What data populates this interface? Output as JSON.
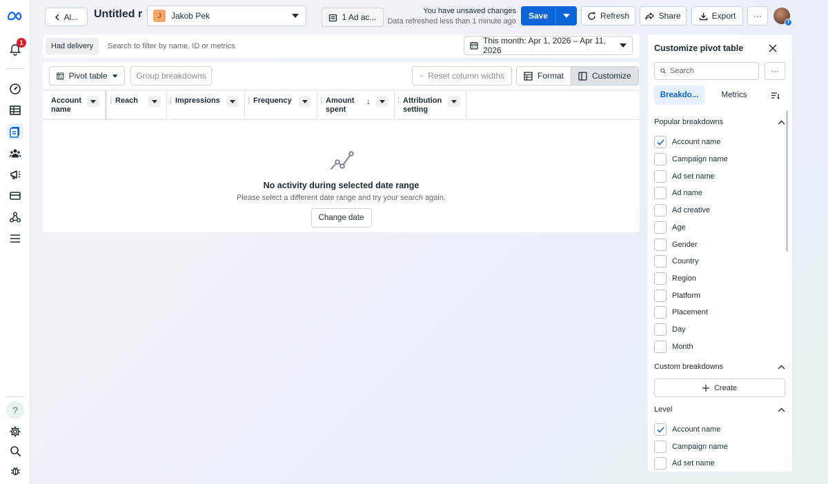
{
  "rail": {
    "notification_count": "1",
    "help_label": "?"
  },
  "header": {
    "back_label": "Al...",
    "report_title": "Untitled r",
    "account": {
      "initial": "J",
      "name": "Jakob Pek"
    },
    "ad_accounts_label": "1 Ad ac...",
    "unsaved_text": "You have unsaved changes",
    "refreshed_text": "Data refreshed less than 1 minute ago",
    "save_label": "Save",
    "refresh_label": "Refresh",
    "share_label": "Share",
    "export_label": "Export",
    "more_label": "···"
  },
  "filters": {
    "chip_label": "Had delivery",
    "search_placeholder": "Search to filter by name, ID or metrics",
    "date_range_label": "This month: Apr 1, 2026 – Apr 11, 2026"
  },
  "toolbar": {
    "pivot_label": "Pivot table",
    "group_label": "Group breakdowns",
    "reset_label": "Reset column widths",
    "format_label": "Format",
    "customize_label": "Customize"
  },
  "table": {
    "columns": [
      {
        "label": "Account\nname"
      },
      {
        "label": "Reach"
      },
      {
        "label": "Impressions"
      },
      {
        "label": "Frequency"
      },
      {
        "label": "Amount\nspent"
      },
      {
        "label": "Attribution\nsetting"
      }
    ],
    "sort_glyph": "↓"
  },
  "empty_state": {
    "title": "No activity during selected date range",
    "subtitle": "Please select a different date range and try your search again.",
    "button_label": "Change date"
  },
  "side_panel": {
    "title": "Customize pivot table",
    "search_placeholder": "Search",
    "more_label": "···",
    "tab_breakdowns": "Breakdo...",
    "tab_metrics": "Metrics",
    "popular_title": "Popular breakdowns",
    "popular_items": [
      {
        "label": "Account name",
        "checked": true
      },
      {
        "label": "Campaign name",
        "checked": false
      },
      {
        "label": "Ad set name",
        "checked": false
      },
      {
        "label": "Ad name",
        "checked": false
      },
      {
        "label": "Ad creative",
        "checked": false
      },
      {
        "label": "Age",
        "checked": false
      },
      {
        "label": "Gender",
        "checked": false
      },
      {
        "label": "Country",
        "checked": false
      },
      {
        "label": "Region",
        "checked": false
      },
      {
        "label": "Platform",
        "checked": false
      },
      {
        "label": "Placement",
        "checked": false
      },
      {
        "label": "Day",
        "checked": false
      },
      {
        "label": "Month",
        "checked": false
      }
    ],
    "custom_title": "Custom breakdowns",
    "create_label": "Create",
    "level_title": "Level",
    "level_items": [
      {
        "label": "Account name",
        "checked": true
      },
      {
        "label": "Campaign name",
        "checked": false
      },
      {
        "label": "Ad set name",
        "checked": false
      }
    ]
  },
  "colors": {
    "primary": "#0a66d8",
    "badge": "#d6202e",
    "active_bg": "#e7f0fd"
  }
}
